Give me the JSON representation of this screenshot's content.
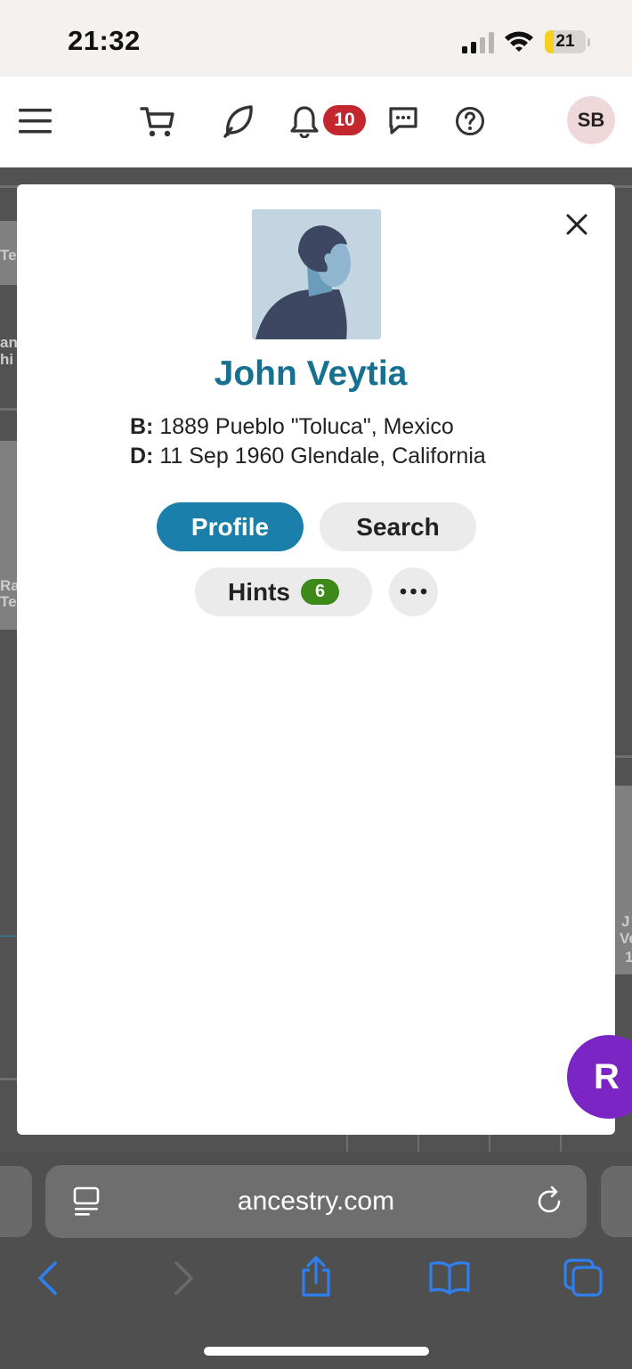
{
  "status_bar": {
    "time": "21:32",
    "battery_level": "21",
    "battery_fraction": 0.21
  },
  "header": {
    "icons": [
      "menu-icon",
      "cart-icon",
      "leaf-hint-icon",
      "bell-icon",
      "message-icon",
      "help-icon"
    ],
    "notification_count": "10",
    "user_initials": "SB",
    "colors": {
      "badge": "#c4262e",
      "avatar_bg": "#efd8da"
    }
  },
  "background_tree": {
    "labels": [
      "Te",
      "an",
      "hi",
      "Ra",
      "Te",
      "J",
      "Ve",
      "1"
    ]
  },
  "person_card": {
    "name": "John Veytia",
    "birth_label": "B:",
    "birth_value": "1889 Pueblo \"Toluca\", Mexico",
    "death_label": "D:",
    "death_value": "11 Sep 1960 Glendale, California",
    "profile_button": "Profile",
    "search_button": "Search",
    "hints_button": "Hints",
    "hints_count": "6",
    "colors": {
      "name": "#16708f",
      "profile_button": "#1b7fab",
      "hints_badge": "#3d8a1a"
    }
  },
  "fab": {
    "label": "R",
    "color": "#7b26c4"
  },
  "browser": {
    "url": "ancestry.com",
    "toolbar_icons": [
      "back-icon",
      "forward-icon",
      "share-icon",
      "bookmarks-icon",
      "tabs-icon"
    ],
    "accent": "#2f7ff0"
  }
}
